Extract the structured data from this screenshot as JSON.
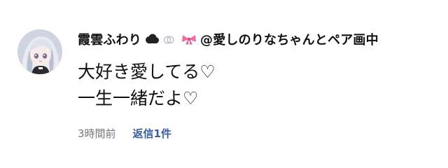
{
  "comment": {
    "avatar": {
      "icon": "avatar-anime-girl"
    },
    "username": "霞雲ふわり",
    "username_emojis": [
      "cloud-icon",
      "rings-icon",
      "ribbon-icon"
    ],
    "username_suffix": "@愛しのりなちゃんとペア画中",
    "message_lines": [
      "大好き愛してる♡",
      "一生一緒だよ♡"
    ],
    "time": "3時間前",
    "reply_link": "返信1件"
  },
  "colors": {
    "text": "#111111",
    "meta": "#777777",
    "link": "#3a5fa0",
    "ribbon": "#f06ca0"
  }
}
